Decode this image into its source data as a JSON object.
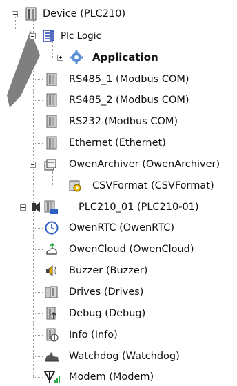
{
  "tree": {
    "root_label": "Device (PLC210)",
    "plc_logic_label": "Plc Logic",
    "application_label": "Application",
    "items": [
      {
        "label": "RS485_1 (Modbus COM)"
      },
      {
        "label": "RS485_2 (Modbus COM)"
      },
      {
        "label": "RS232 (Modbus COM)"
      },
      {
        "label": "Ethernet (Ethernet)"
      },
      {
        "label": "OwenArchiver (OwenArchiver)"
      },
      {
        "label": "CSVFormat (CSVFormat)"
      },
      {
        "label": "PLC210_01 (PLC210-01)"
      },
      {
        "label": "OwenRTC (OwenRTC)"
      },
      {
        "label": "OwenCloud (OwenCloud)"
      },
      {
        "label": "Buzzer (Buzzer)"
      },
      {
        "label": "Drives (Drives)"
      },
      {
        "label": "Debug (Debug)"
      },
      {
        "label": "Info (Info)"
      },
      {
        "label": "Watchdog (Watchdog)"
      },
      {
        "label": "Modem (Modem)"
      }
    ]
  },
  "icons": {
    "device": "device-module-icon",
    "plc_logic": "plc-logic-icon",
    "application": "application-gear-icon",
    "module": "module-icon",
    "archiver": "archiver-icon",
    "csv": "csv-format-icon",
    "plc_io": "plc-io-icon",
    "rtc": "clock-icon",
    "cloud": "cloud-icon",
    "buzzer": "speaker-icon",
    "drives": "drives-icon",
    "debug": "debug-icon",
    "info": "info-icon",
    "watchdog": "watchdog-icon",
    "modem": "modem-antenna-icon",
    "pointer": "pointer-arrow-icon"
  },
  "colors": {
    "background": "#ffffff",
    "tree_line": "#9a9a9a",
    "pointer_arrow": "#7f7f7f",
    "module_icon": "#9c9c9c",
    "gear_blue": "#5a8fd8",
    "clock_blue": "#2f62c5",
    "cloud_green": "#2fa84a"
  }
}
